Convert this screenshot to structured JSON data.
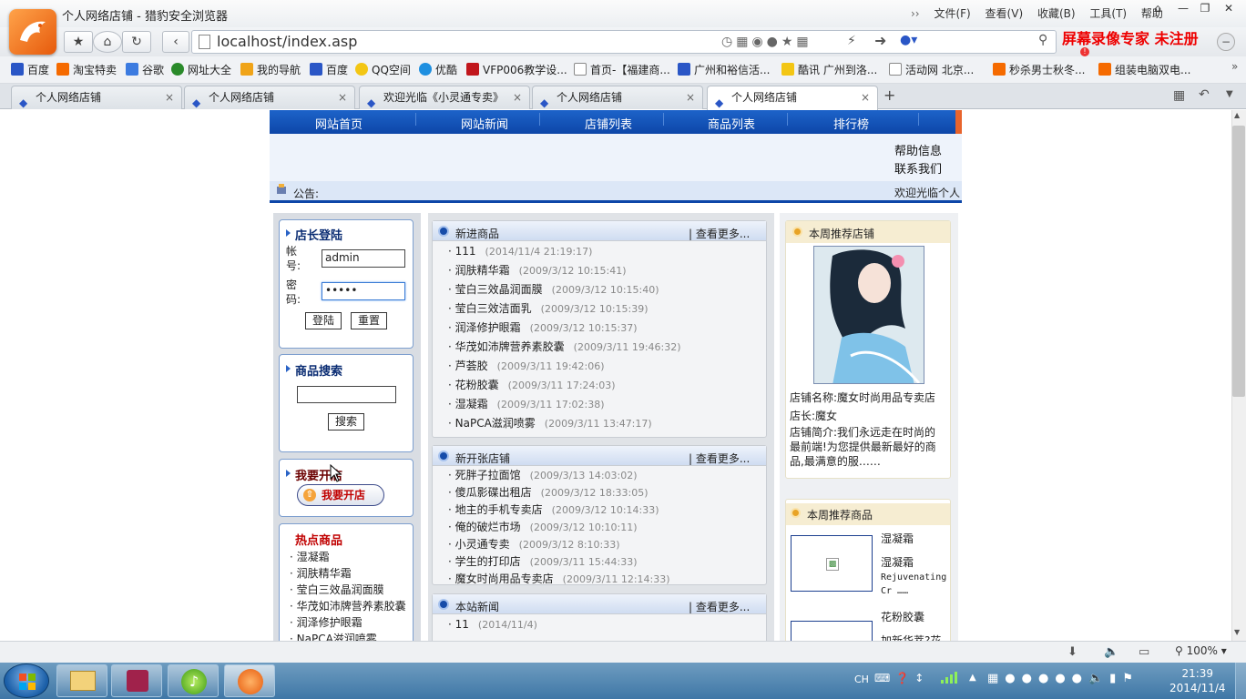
{
  "browser": {
    "window_title": "个人网络店铺 - 猎豹安全浏览器",
    "menu": [
      "文件(F)",
      "查看(V)",
      "收藏(B)",
      "工具(T)",
      "帮助"
    ],
    "address": "localhost/index.asp",
    "watermark": "屏幕录像专家 未注册",
    "bookmarks": [
      "百度",
      "淘宝特卖",
      "谷歌",
      "网址大全",
      "我的导航",
      "百度",
      "QQ空间",
      "优酷",
      "VFP006教学设...",
      "首页-【福建商...",
      "广州和裕信活...",
      "酷讯 广州到洛...",
      "活动网 北京...",
      "秒杀男士秋冬...",
      "组装电脑双电..."
    ],
    "tabs": [
      "个人网络店铺",
      "个人网络店铺",
      "欢迎光临《小灵通专卖》",
      "个人网络店铺",
      "个人网络店铺"
    ],
    "active_tab_index": 4,
    "zoom": "100%"
  },
  "site": {
    "nav": [
      "网站首页",
      "网站新闻",
      "店铺列表",
      "商品列表",
      "排行榜"
    ],
    "help_links": [
      "帮助信息",
      "联系我们"
    ],
    "notice_label": "公告:",
    "notice_text": "欢迎光临个人",
    "login": {
      "title": "店长登陆",
      "user_label": "帐号:",
      "user_value": "admin",
      "pass_label": "密码:",
      "pass_value": "•••••",
      "login_btn": "登陆",
      "reset_btn": "重置"
    },
    "search": {
      "title": "商品搜索",
      "button": "搜索"
    },
    "open_shop": {
      "title": "我要开店",
      "button": "我要开店"
    },
    "hot": {
      "title": "热点商品",
      "items": [
        "湿凝霜",
        "润肤精华霜",
        "莹白三效晶润面膜",
        "华茂如沛牌营养素胶囊",
        "润泽修护眼霜",
        "NaPCA滋润喷雾"
      ]
    },
    "new_products": {
      "title": "新进商品",
      "more": "查看更多...",
      "items": [
        {
          "name": "111",
          "date": "(2014/11/4 21:19:17)"
        },
        {
          "name": "润肤精华霜",
          "date": "(2009/3/12 10:15:41)"
        },
        {
          "name": "莹白三效晶润面膜",
          "date": "(2009/3/12 10:15:40)"
        },
        {
          "name": "莹白三效洁面乳",
          "date": "(2009/3/12 10:15:39)"
        },
        {
          "name": "润泽修护眼霜",
          "date": "(2009/3/12 10:15:37)"
        },
        {
          "name": "华茂如沛牌营养素胶囊",
          "date": "(2009/3/11 19:46:32)"
        },
        {
          "name": "芦荟胶",
          "date": "(2009/3/11 19:42:06)"
        },
        {
          "name": "花粉胶囊",
          "date": "(2009/3/11 17:24:03)"
        },
        {
          "name": "湿凝霜",
          "date": "(2009/3/11 17:02:38)"
        },
        {
          "name": "NaPCA滋润喷雾",
          "date": "(2009/3/11 13:47:17)"
        }
      ]
    },
    "new_shops": {
      "title": "新开张店铺",
      "more": "查看更多...",
      "items": [
        {
          "name": "死胖子拉面馆",
          "date": "(2009/3/13 14:03:02)"
        },
        {
          "name": "傻瓜影碟出租店",
          "date": "(2009/3/12 18:33:05)"
        },
        {
          "name": "地主的手机专卖店",
          "date": "(2009/3/12 10:14:33)"
        },
        {
          "name": "俺的破烂市场",
          "date": "(2009/3/12 10:10:11)"
        },
        {
          "name": "小灵通专卖",
          "date": "(2009/3/12 8:10:33)"
        },
        {
          "name": "学生的打印店",
          "date": "(2009/3/11 15:44:33)"
        },
        {
          "name": "魔女时尚用品专卖店",
          "date": "(2009/3/11 12:14:33)"
        }
      ]
    },
    "site_news": {
      "title": "本站新闻",
      "more": "查看更多...",
      "items": [
        {
          "name": "11",
          "date": "(2014/11/4)"
        }
      ]
    },
    "weekly_shop": {
      "title": "本周推荐店铺",
      "name_label": "店铺名称:",
      "name": "魔女时尚用品专卖店",
      "owner_label": "店长:",
      "owner": "魔女",
      "intro_label": "店铺简介:",
      "intro": "我们永远走在时尚的最前端!为您提供最新最好的商品,最满意的服……"
    },
    "weekly_products": {
      "title": "本周推荐商品",
      "items": [
        {
          "name": "湿凝霜",
          "desc_name": "湿凝霜",
          "desc": "Rejuvenating Cr ……"
        },
        {
          "name": "花粉胶囊",
          "desc_name": "加新华萃?花"
        }
      ]
    }
  },
  "taskbar": {
    "ime": "CH",
    "time": "21:39",
    "date": "2014/11/4"
  },
  "colors": {
    "nav_blue": "#0d46a8",
    "accent_orange": "#e8642c",
    "title_navy": "#0b2d73",
    "hot_red": "#c00000"
  }
}
